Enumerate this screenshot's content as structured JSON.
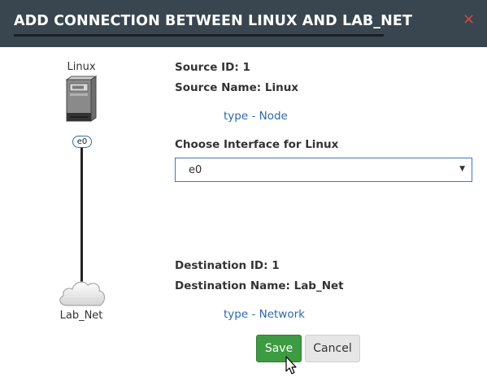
{
  "dialog": {
    "title": "ADD CONNECTION BETWEEN LINUX AND LAB_NET",
    "close_label": "×"
  },
  "diagram": {
    "source_node_label": "Linux",
    "source_interface": "e0",
    "destination_node_label": "Lab_Net"
  },
  "source": {
    "id_label": "Source ID: 1",
    "name_label": "Source Name: Linux",
    "type_link": "type - Node",
    "interface_prompt": "Choose Interface for Linux",
    "interface_selected": "e0"
  },
  "destination": {
    "id_label": "Destination ID: 1",
    "name_label": "Destination Name: Lab_Net",
    "type_link": "type - Network"
  },
  "actions": {
    "save_label": "Save",
    "cancel_label": "Cancel"
  },
  "colors": {
    "header_bg": "#39464f",
    "save_green": "#3d9b41",
    "link_blue": "#2a6aa8",
    "close_red": "#e0483e"
  }
}
